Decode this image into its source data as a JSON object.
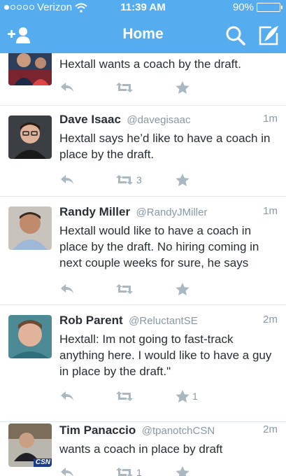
{
  "status_bar": {
    "carrier": "Verizon",
    "time": "11:39 AM",
    "battery": "90%",
    "battery_level": 0.9
  },
  "nav": {
    "title": "Home",
    "icons": [
      "add-user-icon",
      "search-icon",
      "compose-icon"
    ]
  },
  "tweets": [
    {
      "name": "",
      "handle": "",
      "time": "",
      "text": "Hextall wants a coach by the draft.",
      "retweets": "",
      "favorites": ""
    },
    {
      "name": "Dave Isaac",
      "handle": "@davegisaac",
      "time": "1m",
      "text": "Hextall says he’d like to have a coach in place by the draft.",
      "retweets": "3",
      "favorites": ""
    },
    {
      "name": "Randy Miller",
      "handle": "@RandyJMiller",
      "time": "1m",
      "text": "Hextall would like to have a coach in place by the draft. No hiring coming in next couple weeks for sure, he says",
      "retweets": "",
      "favorites": ""
    },
    {
      "name": "Rob Parent",
      "handle": "@ReluctantSE",
      "time": "2m",
      "text": "Hextall: Im not going to fast-track anything here. I would like to have a guy in place by the draft.\"",
      "retweets": "",
      "favorites": "1"
    },
    {
      "name": "Tim Panaccio",
      "handle": "@tpanotchCSN",
      "time": "2m",
      "text": "wants a coach in place by draft",
      "retweets": "1",
      "favorites": "",
      "avatar_badge": "CSN"
    }
  ],
  "colors": {
    "brand": "#55acee",
    "text": "#292f33",
    "muted": "#8899a6",
    "icon": "#aab8c2",
    "divider": "#e1e8ed"
  }
}
